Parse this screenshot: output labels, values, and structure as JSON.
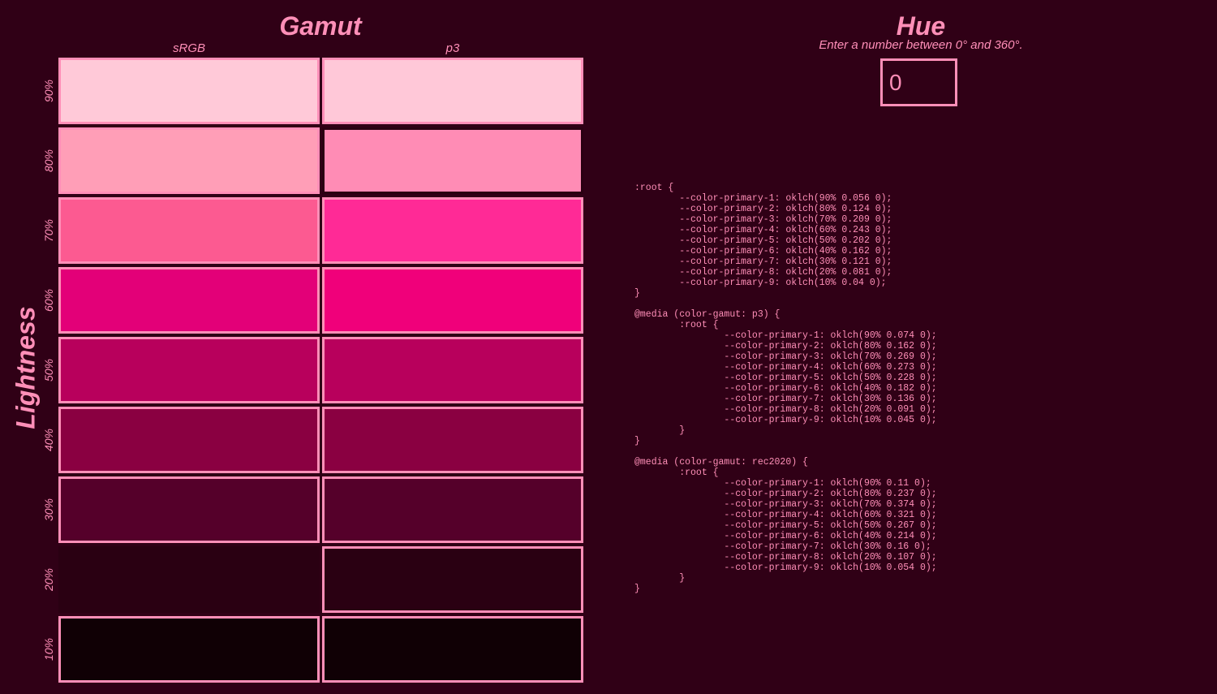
{
  "gamut": {
    "title": "Gamut",
    "columns": [
      "sRGB",
      "p3"
    ]
  },
  "lightness": {
    "title": "Lightness",
    "rows": [
      "90%",
      "80%",
      "70%",
      "60%",
      "50%",
      "40%",
      "30%",
      "20%",
      "10%"
    ]
  },
  "swatches": {
    "srgb": [
      "#ffc9d8",
      "#ff9eb7",
      "#fc5a91",
      "#e30078",
      "#b8005c",
      "#8a0041",
      "#55002a",
      "#2a0012",
      "#100005"
    ],
    "p3": [
      "#ffc8d8",
      "#ff8cb5",
      "#ff2a96",
      "#f0007a",
      "#b8005c",
      "#8a0041",
      "#55002a",
      "#2a0012",
      "#100005"
    ],
    "srgb_in_gamut": [
      true,
      true,
      true,
      true,
      true,
      true,
      true,
      false,
      true
    ],
    "p3_in_gamut": [
      true,
      false,
      true,
      true,
      true,
      true,
      true,
      true,
      true
    ]
  },
  "hue": {
    "title": "Hue",
    "hint": "Enter a number between 0° and 360°.",
    "value": "0"
  },
  "css_output": ":root {\n\t--color-primary-1: oklch(90% 0.056 0);\n\t--color-primary-2: oklch(80% 0.124 0);\n\t--color-primary-3: oklch(70% 0.209 0);\n\t--color-primary-4: oklch(60% 0.243 0);\n\t--color-primary-5: oklch(50% 0.202 0);\n\t--color-primary-6: oklch(40% 0.162 0);\n\t--color-primary-7: oklch(30% 0.121 0);\n\t--color-primary-8: oklch(20% 0.081 0);\n\t--color-primary-9: oklch(10% 0.04 0);\n}\n\n@media (color-gamut: p3) {\n\t:root {\n\t\t--color-primary-1: oklch(90% 0.074 0);\n\t\t--color-primary-2: oklch(80% 0.162 0);\n\t\t--color-primary-3: oklch(70% 0.269 0);\n\t\t--color-primary-4: oklch(60% 0.273 0);\n\t\t--color-primary-5: oklch(50% 0.228 0);\n\t\t--color-primary-6: oklch(40% 0.182 0);\n\t\t--color-primary-7: oklch(30% 0.136 0);\n\t\t--color-primary-8: oklch(20% 0.091 0);\n\t\t--color-primary-9: oklch(10% 0.045 0);\n\t}\n}\n\n@media (color-gamut: rec2020) {\n\t:root {\n\t\t--color-primary-1: oklch(90% 0.11 0);\n\t\t--color-primary-2: oklch(80% 0.237 0);\n\t\t--color-primary-3: oklch(70% 0.374 0);\n\t\t--color-primary-4: oklch(60% 0.321 0);\n\t\t--color-primary-5: oklch(50% 0.267 0);\n\t\t--color-primary-6: oklch(40% 0.214 0);\n\t\t--color-primary-7: oklch(30% 0.16 0);\n\t\t--color-primary-8: oklch(20% 0.107 0);\n\t\t--color-primary-9: oklch(10% 0.054 0);\n\t}\n}",
  "colors": {
    "background": "#300016",
    "accent": "#ff8fb8"
  }
}
